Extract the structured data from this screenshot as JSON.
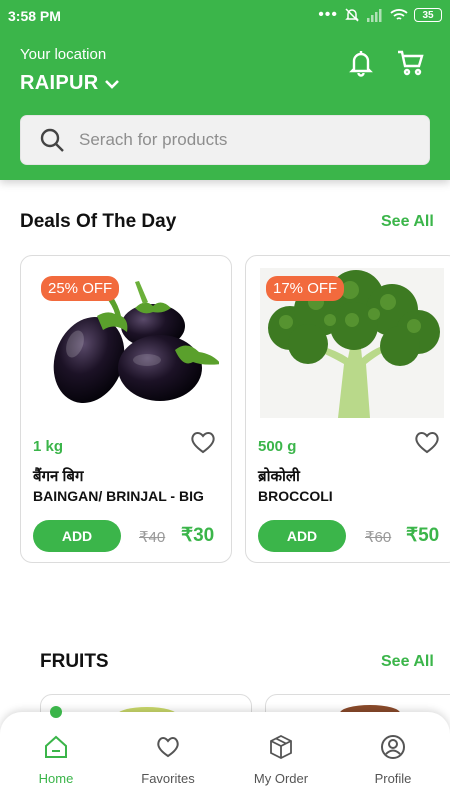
{
  "status_bar": {
    "time": "3:58 PM",
    "battery": "35"
  },
  "header": {
    "location_label": "Your location",
    "city": "RAIPUR",
    "search_placeholder": "Serach for products"
  },
  "deals": {
    "title": "Deals Of The Day",
    "see_all": "See All",
    "products": [
      {
        "discount": "25% OFF",
        "quantity": "1 kg",
        "name_hindi": "बैंगन बिग",
        "name": "BAINGAN/ BRINJAL - BIG",
        "add_label": "ADD",
        "mrp": "₹40",
        "price": "₹30"
      },
      {
        "discount": "17% OFF",
        "quantity": "500 g",
        "name_hindi": "ब्रोकोली",
        "name": "BROCCOLI",
        "add_label": "ADD",
        "mrp": "₹60",
        "price": "₹50"
      }
    ]
  },
  "fruits": {
    "title": "FRUITS",
    "see_all": "See All"
  },
  "nav": {
    "items": [
      {
        "label": "Home",
        "icon": "home-icon"
      },
      {
        "label": "Favorites",
        "icon": "heart-icon"
      },
      {
        "label": "My Order",
        "icon": "box-icon"
      },
      {
        "label": "Profile",
        "icon": "user-icon"
      }
    ],
    "active_color": "#3bb54a"
  },
  "colors": {
    "brand": "#3bb54a",
    "badge": "#f26a3d"
  }
}
